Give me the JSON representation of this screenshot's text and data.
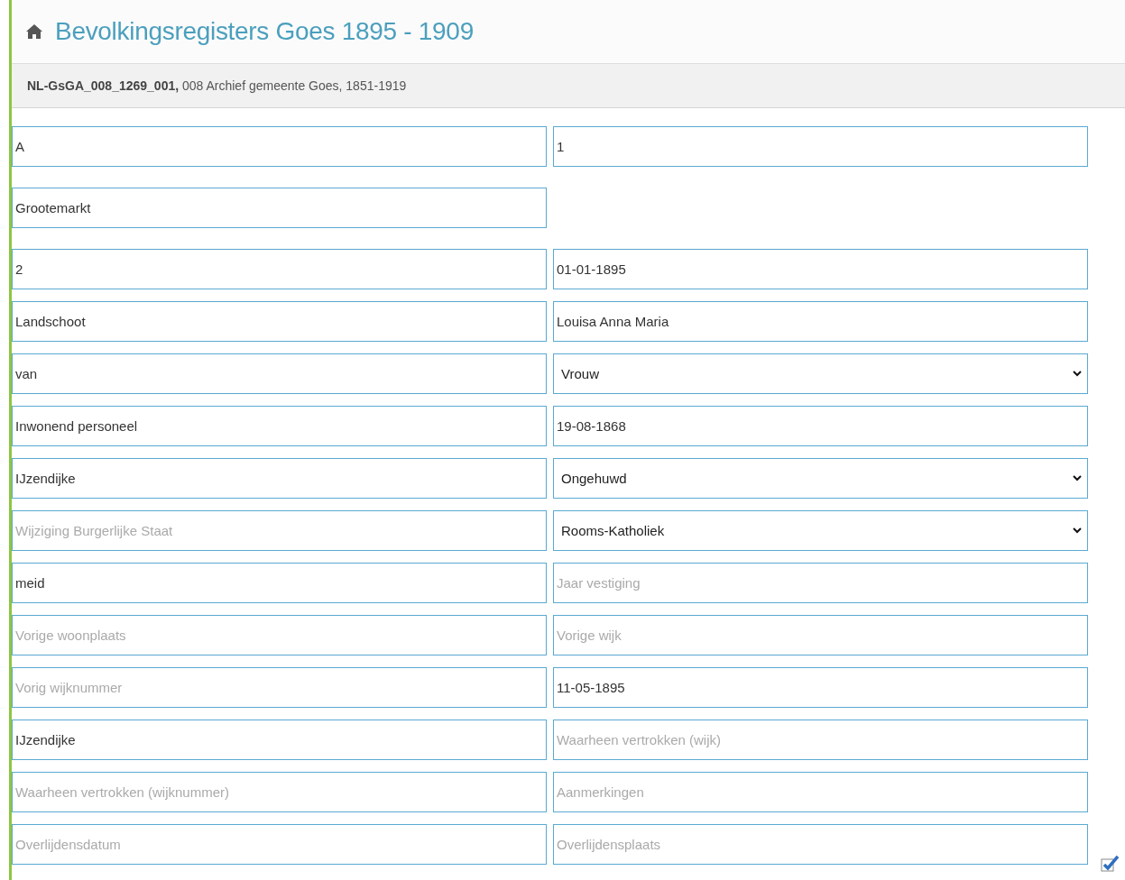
{
  "header": {
    "title": "Bevolkingsregisters Goes 1895 - 1909"
  },
  "subheader": {
    "code": "NL-GsGA_008_1269_001,",
    "description": "008 Archief gemeente Goes, 1851-1919"
  },
  "rows": [
    {
      "cells": [
        {
          "kind": "text",
          "value": "A"
        },
        {
          "kind": "text",
          "value": "1"
        }
      ]
    },
    {
      "cells": [
        {
          "kind": "text",
          "value": "Grootemarkt"
        }
      ]
    },
    {
      "cells": [
        {
          "kind": "text",
          "value": "2"
        },
        {
          "kind": "text",
          "value": "01-01-1895"
        }
      ]
    },
    {
      "cells": [
        {
          "kind": "text",
          "value": "Landschoot"
        },
        {
          "kind": "text",
          "value": "Louisa Anna Maria"
        }
      ]
    },
    {
      "cells": [
        {
          "kind": "text",
          "value": "van"
        },
        {
          "kind": "select",
          "value": "Vrouw"
        }
      ]
    },
    {
      "cells": [
        {
          "kind": "text",
          "value": "Inwonend personeel"
        },
        {
          "kind": "text",
          "value": "19-08-1868"
        }
      ]
    },
    {
      "cells": [
        {
          "kind": "text",
          "value": "IJzendijke"
        },
        {
          "kind": "select",
          "value": "Ongehuwd"
        }
      ]
    },
    {
      "cells": [
        {
          "kind": "text",
          "placeholder": "Wijziging Burgerlijke Staat"
        },
        {
          "kind": "select",
          "value": "Rooms-Katholiek"
        }
      ]
    },
    {
      "cells": [
        {
          "kind": "text",
          "value": "meid"
        },
        {
          "kind": "text",
          "placeholder": "Jaar vestiging"
        }
      ]
    },
    {
      "cells": [
        {
          "kind": "text",
          "placeholder": "Vorige woonplaats"
        },
        {
          "kind": "text",
          "placeholder": "Vorige wijk"
        }
      ]
    },
    {
      "cells": [
        {
          "kind": "text",
          "placeholder": "Vorig wijknummer"
        },
        {
          "kind": "text",
          "value": "11-05-1895"
        }
      ]
    },
    {
      "cells": [
        {
          "kind": "text",
          "value": "IJzendijke"
        },
        {
          "kind": "text",
          "placeholder": "Waarheen vertrokken (wijk)"
        }
      ]
    },
    {
      "cells": [
        {
          "kind": "text",
          "placeholder": "Waarheen vertrokken (wijknummer)"
        },
        {
          "kind": "text",
          "placeholder": "Aanmerkingen"
        }
      ]
    },
    {
      "cells": [
        {
          "kind": "text",
          "placeholder": "Overlijdensdatum"
        },
        {
          "kind": "text",
          "placeholder": "Overlijdensplaats"
        }
      ]
    }
  ]
}
